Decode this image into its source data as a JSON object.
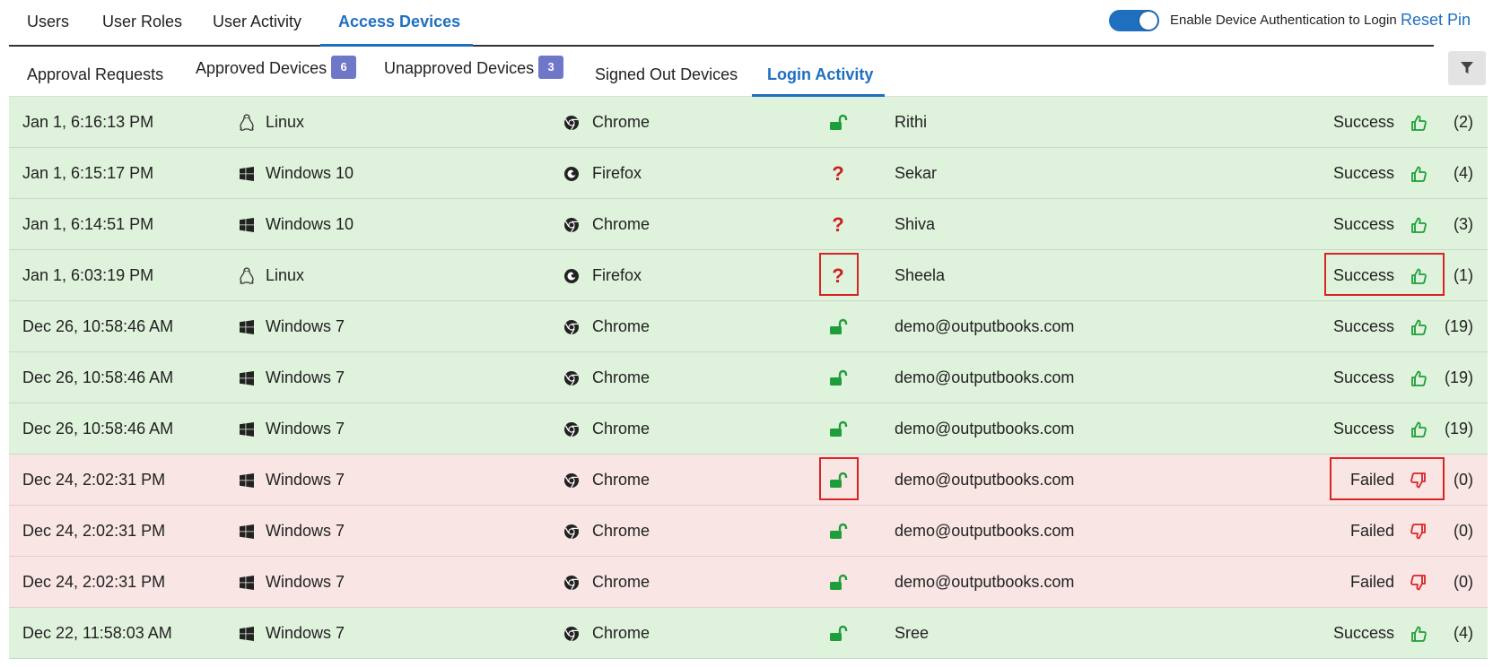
{
  "top_tabs": [
    {
      "label": "Users"
    },
    {
      "label": "User Roles"
    },
    {
      "label": "User Activity"
    },
    {
      "label": "Access Devices",
      "active": true
    }
  ],
  "device_auth": {
    "label": "Enable Device Authentication to Login",
    "enabled": true
  },
  "reset_pin_label": "Reset Pin",
  "sub_tabs": [
    {
      "label": "Approval Requests"
    },
    {
      "label": "Approved Devices",
      "badge": "6"
    },
    {
      "label": "Unapproved Devices",
      "badge": "3"
    },
    {
      "label": "Signed Out Devices"
    },
    {
      "label": "Login Activity",
      "active": true
    }
  ],
  "colors": {
    "accent": "#1f6fbf",
    "success_bg": "#dff2dc",
    "failed_bg": "#f8e5e4",
    "success_icon": "#1e9e3a",
    "failed_icon": "#d92424",
    "badge": "#6f77c8"
  },
  "rows": [
    {
      "date": "Jan 1, 6:16:13 PM",
      "os": "Linux",
      "os_icon": "linux-icon",
      "browser": "Chrome",
      "browser_icon": "chrome-icon",
      "auth": "unlocked",
      "user": "Rithi",
      "status": "Success",
      "count": "(2)"
    },
    {
      "date": "Jan 1, 6:15:17 PM",
      "os": "Windows 10",
      "os_icon": "windows-icon",
      "browser": "Firefox",
      "browser_icon": "firefox-icon",
      "auth": "unknown",
      "user": "Sekar",
      "status": "Success",
      "count": "(4)"
    },
    {
      "date": "Jan 1, 6:14:51 PM",
      "os": "Windows 10",
      "os_icon": "windows-icon",
      "browser": "Chrome",
      "browser_icon": "chrome-icon",
      "auth": "unknown",
      "user": "Shiva",
      "status": "Success",
      "count": "(3)"
    },
    {
      "date": "Jan 1, 6:03:19 PM",
      "os": "Linux",
      "os_icon": "linux-icon",
      "browser": "Firefox",
      "browser_icon": "firefox-icon",
      "auth": "unknown",
      "user": "Sheela",
      "status": "Success",
      "count": "(1)",
      "highlighted": true
    },
    {
      "date": "Dec 26, 10:58:46 AM",
      "os": "Windows 7",
      "os_icon": "windows-icon",
      "browser": "Chrome",
      "browser_icon": "chrome-icon",
      "auth": "unlocked",
      "user": "demo@outputbooks.com",
      "status": "Success",
      "count": "(19)"
    },
    {
      "date": "Dec 26, 10:58:46 AM",
      "os": "Windows 7",
      "os_icon": "windows-icon",
      "browser": "Chrome",
      "browser_icon": "chrome-icon",
      "auth": "unlocked",
      "user": "demo@outputbooks.com",
      "status": "Success",
      "count": "(19)"
    },
    {
      "date": "Dec 26, 10:58:46 AM",
      "os": "Windows 7",
      "os_icon": "windows-icon",
      "browser": "Chrome",
      "browser_icon": "chrome-icon",
      "auth": "unlocked",
      "user": "demo@outputbooks.com",
      "status": "Success",
      "count": "(19)"
    },
    {
      "date": "Dec 24, 2:02:31 PM",
      "os": "Windows 7",
      "os_icon": "windows-icon",
      "browser": "Chrome",
      "browser_icon": "chrome-icon",
      "auth": "unlocked",
      "user": "demo@outputbooks.com",
      "status": "Failed",
      "count": "(0)",
      "highlighted": true
    },
    {
      "date": "Dec 24, 2:02:31 PM",
      "os": "Windows 7",
      "os_icon": "windows-icon",
      "browser": "Chrome",
      "browser_icon": "chrome-icon",
      "auth": "unlocked",
      "user": "demo@outputbooks.com",
      "status": "Failed",
      "count": "(0)"
    },
    {
      "date": "Dec 24, 2:02:31 PM",
      "os": "Windows 7",
      "os_icon": "windows-icon",
      "browser": "Chrome",
      "browser_icon": "chrome-icon",
      "auth": "unlocked",
      "user": "demo@outputbooks.com",
      "status": "Failed",
      "count": "(0)"
    },
    {
      "date": "Dec 22, 11:58:03 AM",
      "os": "Windows 7",
      "os_icon": "windows-icon",
      "browser": "Chrome",
      "browser_icon": "chrome-icon",
      "auth": "unlocked",
      "user": "Sree",
      "status": "Success",
      "count": "(4)"
    }
  ]
}
